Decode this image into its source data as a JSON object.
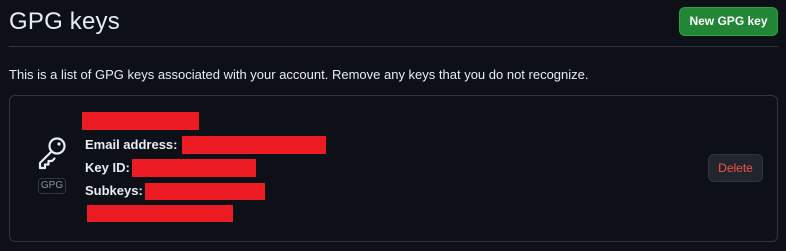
{
  "header": {
    "title": "GPG keys",
    "new_key_label": "New GPG key"
  },
  "description": "This is a list of GPG keys associated with your account. Remove any keys that you do not recognize.",
  "key": {
    "badge": "GPG",
    "email_label": "Email address:",
    "key_id_label": "Key ID:",
    "subkeys_label": "Subkeys:",
    "delete_label": "Delete",
    "redaction_color": "#ed1c24"
  },
  "colors": {
    "background": "#0d1117",
    "border": "#30363d",
    "primary_button": "#238636",
    "danger_text": "#f85149"
  },
  "icons": {
    "key": "key-icon"
  }
}
